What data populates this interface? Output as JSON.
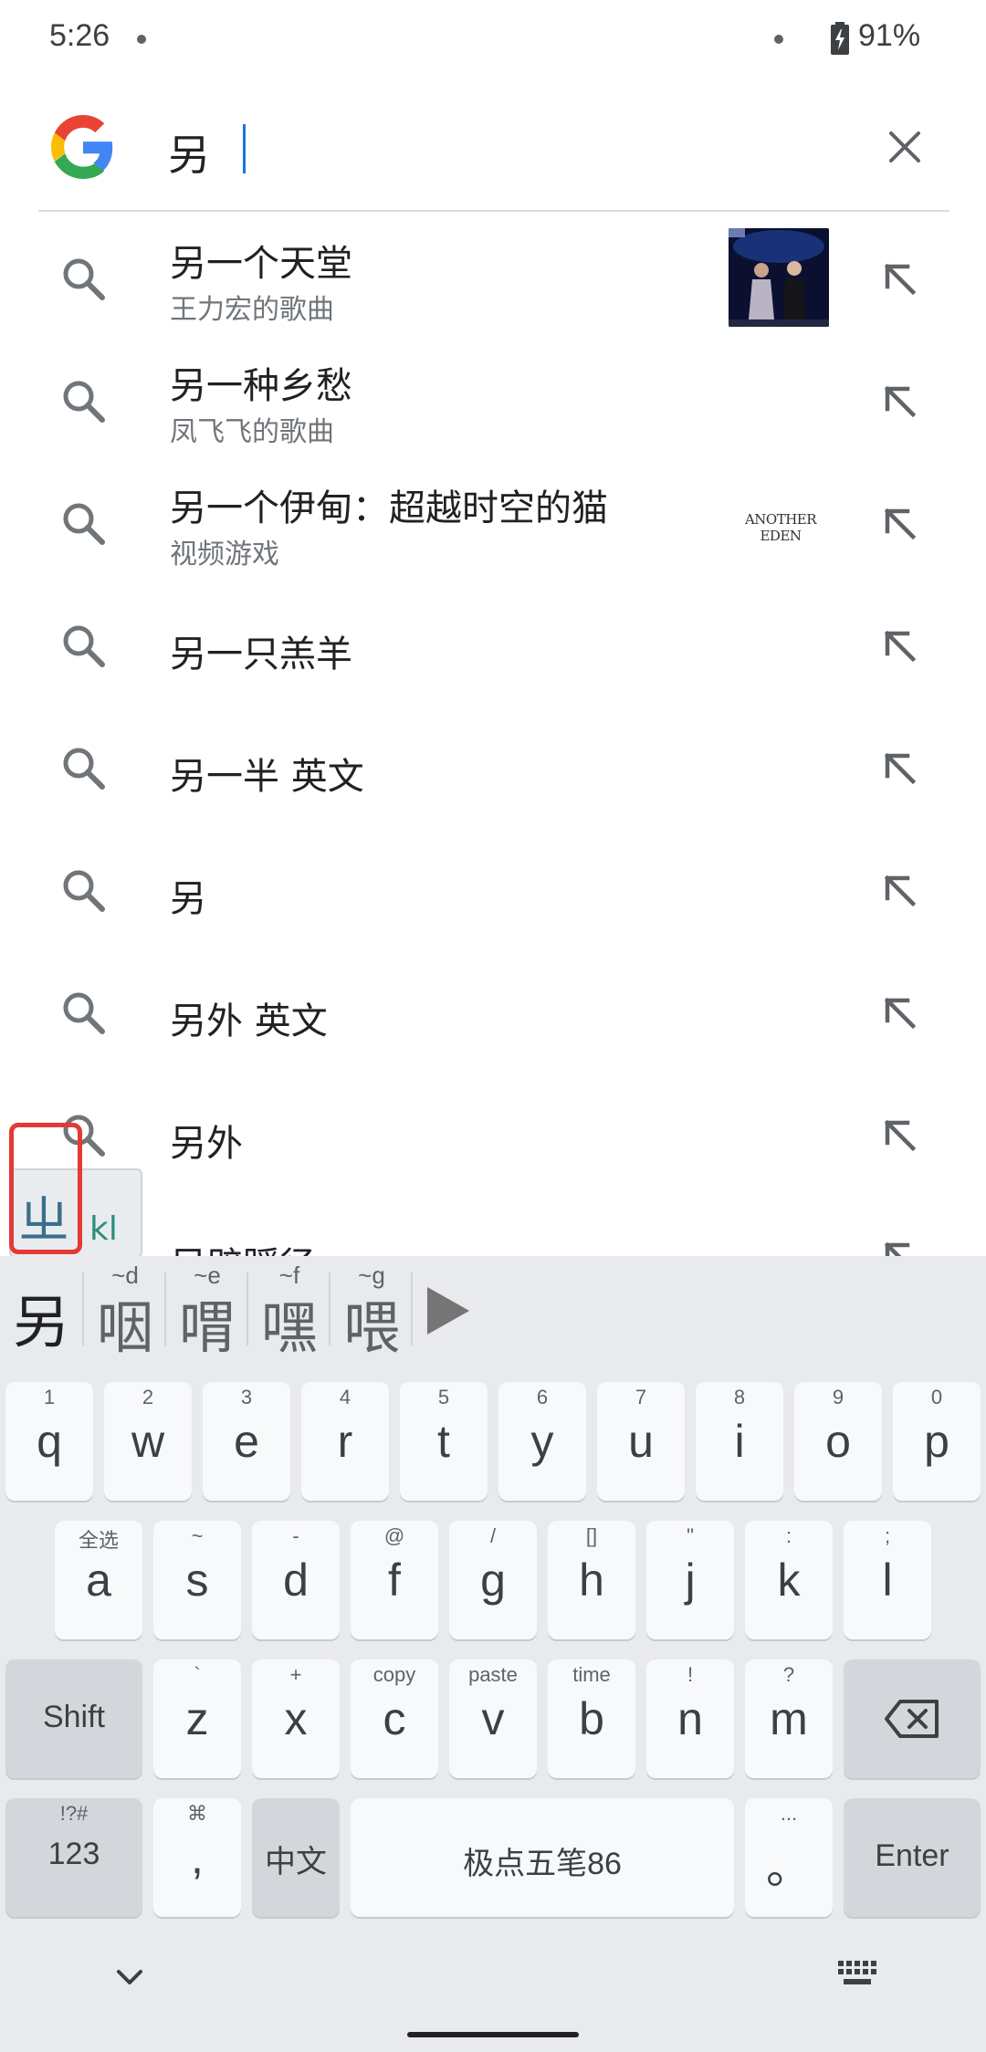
{
  "status_bar": {
    "time": "5:26",
    "battery_percent": "91%"
  },
  "search": {
    "query": "另",
    "icons": {
      "logo": "google-g-logo",
      "clear": "close-icon"
    }
  },
  "suggestions": [
    {
      "text": "另一个天堂",
      "subtitle": "王力宏的歌曲",
      "thumbnail": "concert-photo"
    },
    {
      "text": "另一种乡愁",
      "subtitle": "凤飞飞的歌曲"
    },
    {
      "text": "另一个伊甸：超越时空的猫",
      "subtitle": "视频游戏",
      "logo_text": "ANOTHER EDEN"
    },
    {
      "text": "另一只羔羊"
    },
    {
      "text": "另一半 英文"
    },
    {
      "text": "另"
    },
    {
      "text": "另外 英文"
    },
    {
      "text": "另外"
    },
    {
      "text": "另辟蹊径"
    }
  ],
  "ime_bubble": {
    "radical": "ㄓ",
    "code": "kl"
  },
  "candidates": [
    {
      "char": "另",
      "code": ""
    },
    {
      "char": "咽",
      "code": "~d"
    },
    {
      "char": "喟",
      "code": "~e"
    },
    {
      "char": "嘿",
      "code": "~f"
    },
    {
      "char": "喂",
      "code": "~g"
    }
  ],
  "keyboard": {
    "row1": [
      {
        "key": "q",
        "hint": "1"
      },
      {
        "key": "w",
        "hint": "2"
      },
      {
        "key": "e",
        "hint": "3"
      },
      {
        "key": "r",
        "hint": "4"
      },
      {
        "key": "t",
        "hint": "5"
      },
      {
        "key": "y",
        "hint": "6"
      },
      {
        "key": "u",
        "hint": "7"
      },
      {
        "key": "i",
        "hint": "8"
      },
      {
        "key": "o",
        "hint": "9"
      },
      {
        "key": "p",
        "hint": "0"
      }
    ],
    "row2": [
      {
        "key": "a",
        "hint": "全选"
      },
      {
        "key": "s",
        "hint": "~"
      },
      {
        "key": "d",
        "hint": "-"
      },
      {
        "key": "f",
        "hint": "@"
      },
      {
        "key": "g",
        "hint": "/"
      },
      {
        "key": "h",
        "hint": "[]"
      },
      {
        "key": "j",
        "hint": "\""
      },
      {
        "key": "k",
        "hint": ":"
      },
      {
        "key": "l",
        "hint": ";"
      }
    ],
    "row3": [
      {
        "key": "z",
        "hint": "`"
      },
      {
        "key": "x",
        "hint": "+"
      },
      {
        "key": "c",
        "hint": "copy"
      },
      {
        "key": "v",
        "hint": "paste"
      },
      {
        "key": "b",
        "hint": "time"
      },
      {
        "key": "n",
        "hint": "!"
      },
      {
        "key": "m",
        "hint": "?"
      }
    ],
    "shift_label": "Shift",
    "num_label": "123",
    "num_hint": "!?#",
    "comma_label": ",",
    "comma_hint": "⌘",
    "lang_label": "中文",
    "space_label": "极点五笔86",
    "period_label": "。",
    "period_hint": "...",
    "enter_label": "Enter"
  }
}
